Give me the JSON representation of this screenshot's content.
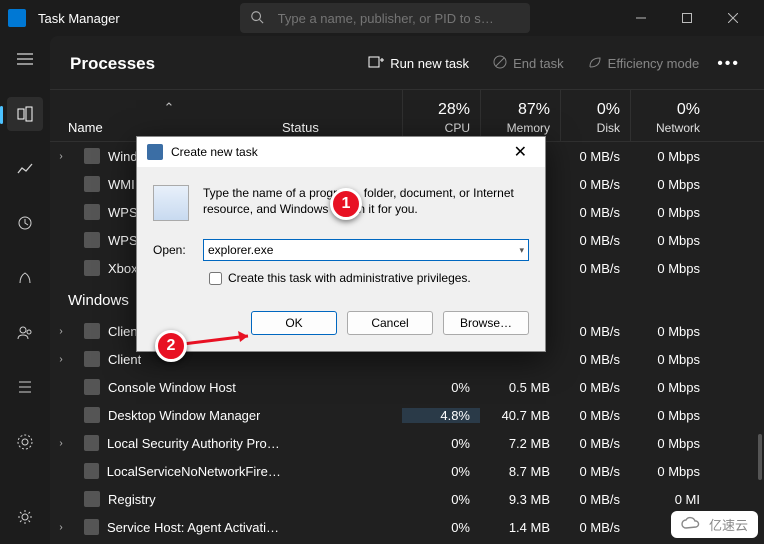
{
  "title": "Task Manager",
  "search": {
    "placeholder": "Type a name, publisher, or PID to s…"
  },
  "header": {
    "title": "Processes",
    "runNewTask": "Run new task",
    "endTask": "End task",
    "efficiency": "Efficiency mode"
  },
  "columns": {
    "name": "Name",
    "status": "Status",
    "cpu": {
      "pct": "28%",
      "label": "CPU"
    },
    "mem": {
      "pct": "87%",
      "label": "Memory"
    },
    "disk": {
      "pct": "0%",
      "label": "Disk"
    },
    "net": {
      "pct": "0%",
      "label": "Network"
    }
  },
  "group": "Windows",
  "rows": [
    {
      "expander": true,
      "name": "Wind",
      "cpu": "",
      "mem": "",
      "disk": "0 MB/s",
      "net": "0 Mbps"
    },
    {
      "expander": false,
      "name": "WMI",
      "cpu": "",
      "mem": "",
      "disk": "0 MB/s",
      "net": "0 Mbps"
    },
    {
      "expander": false,
      "name": "WPS",
      "cpu": "",
      "mem": "",
      "disk": "0 MB/s",
      "net": "0 Mbps"
    },
    {
      "expander": false,
      "name": "WPS",
      "cpu": "",
      "mem": "",
      "disk": "0 MB/s",
      "net": "0 Mbps"
    },
    {
      "expander": false,
      "name": "Xbox",
      "cpu": "",
      "mem": "",
      "disk": "0 MB/s",
      "net": "0 Mbps"
    }
  ],
  "rows2": [
    {
      "expander": true,
      "name": "Client",
      "cpu": "",
      "mem": "",
      "disk": "0 MB/s",
      "net": "0 Mbps",
      "hi": false
    },
    {
      "expander": true,
      "name": "Client",
      "cpu": "",
      "mem": "",
      "disk": "0 MB/s",
      "net": "0 Mbps",
      "hi": false
    },
    {
      "expander": false,
      "name": "Console Window Host",
      "cpu": "0%",
      "mem": "0.5 MB",
      "disk": "0 MB/s",
      "net": "0 Mbps",
      "hi": false
    },
    {
      "expander": false,
      "name": "Desktop Window Manager",
      "cpu": "4.8%",
      "mem": "40.7 MB",
      "disk": "0 MB/s",
      "net": "0 Mbps",
      "hi": true
    },
    {
      "expander": true,
      "name": "Local Security Authority Proce…",
      "cpu": "0%",
      "mem": "7.2 MB",
      "disk": "0 MB/s",
      "net": "0 Mbps",
      "hi": false
    },
    {
      "expander": false,
      "name": "LocalServiceNoNetworkFirewa…",
      "cpu": "0%",
      "mem": "8.7 MB",
      "disk": "0 MB/s",
      "net": "0 Mbps",
      "hi": false
    },
    {
      "expander": false,
      "name": "Registry",
      "cpu": "0%",
      "mem": "9.3 MB",
      "disk": "0 MB/s",
      "net": "0 MI",
      "hi": false
    },
    {
      "expander": true,
      "name": "Service Host: Agent Activation…",
      "cpu": "0%",
      "mem": "1.4 MB",
      "disk": "0 MB/s",
      "net": "0",
      "hi": false
    }
  ],
  "dialog": {
    "title": "Create new task",
    "message": "Type the name of a program, folder, document, or Internet resource, and Windows will open it for you.",
    "openLabel": "Open:",
    "value": "explorer.exe",
    "adminLabel": "Create this task with administrative privileges.",
    "ok": "OK",
    "cancel": "Cancel",
    "browse": "Browse…"
  },
  "annotations": {
    "a1": "1",
    "a2": "2"
  },
  "watermark": "亿速云"
}
